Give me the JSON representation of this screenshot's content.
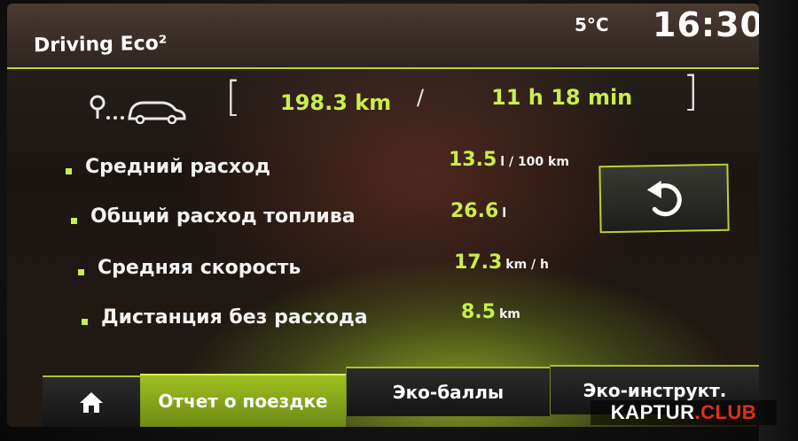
{
  "header": {
    "title": "Driving Eco²",
    "temperature": "5°C",
    "clock": "16:30"
  },
  "trip": {
    "distance": "198.3 km",
    "duration": "11 h 18 min",
    "bracket_open": "[",
    "bracket_close": "]",
    "separator": "/"
  },
  "stats": [
    {
      "label": "Средний расход",
      "value": "13.5",
      "unit": "l / 100 km"
    },
    {
      "label": "Общий расход топлива",
      "value": "26.6",
      "unit": "l"
    },
    {
      "label": "Средняя скорость",
      "value": "17.3",
      "unit": "km / h"
    },
    {
      "label": "Дистанция без расхода",
      "value": "8.5",
      "unit": "km"
    }
  ],
  "tabs": {
    "trip_report": "Отчет о поездке",
    "eco_points": "Эко-баллы",
    "eco_instructions": "Эко-инструкт."
  },
  "watermark": {
    "brand": "KAPTUR",
    "dot": ".",
    "suffix": "CLUB"
  },
  "colors": {
    "accent": "#c7ef4a",
    "text": "#f2f2f2",
    "active_tab": "#9fc020"
  }
}
